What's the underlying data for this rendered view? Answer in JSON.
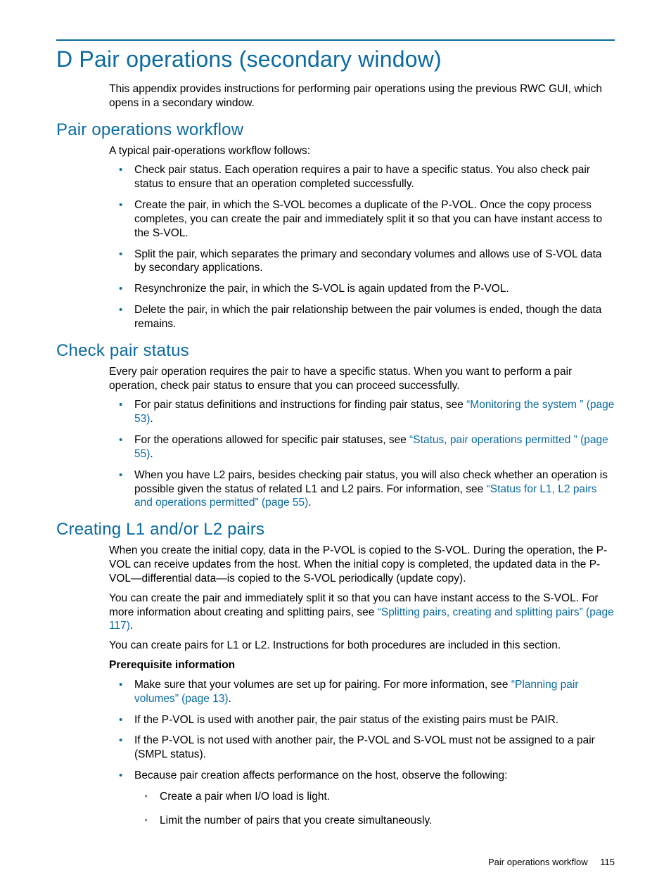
{
  "appendix_title": "D Pair operations (secondary window)",
  "intro": "This appendix provides instructions for performing pair operations using the previous RWC GUI, which opens in a secondary window.",
  "sections": {
    "workflow": {
      "title": "Pair operations workflow",
      "lead": "A typical pair-operations workflow follows:",
      "items": [
        "Check pair status. Each operation requires a pair to have a specific status. You also check pair status to ensure that an operation completed successfully.",
        "Create the pair, in which the S-VOL becomes a duplicate of the P-VOL. Once the copy process completes, you can create the pair and immediately split it so that you can have instant access to the S-VOL.",
        "Split the pair, which separates the primary and secondary volumes and allows use of S-VOL data by secondary applications.",
        "Resynchronize the pair, in which the S-VOL is again updated from the P-VOL.",
        "Delete the pair, in which the pair relationship between the pair volumes is ended, though the data remains."
      ]
    },
    "check": {
      "title": "Check pair status",
      "lead": "Every pair operation requires the pair to have a specific status. When you want to perform a pair operation, check pair status to ensure that you can proceed successfully.",
      "items": {
        "b1_pre": "For pair status definitions and instructions for finding pair status, see ",
        "b1_link": "“Monitoring the system ” (page 53)",
        "b1_post": ".",
        "b2_pre": "For the operations allowed for specific pair statuses, see ",
        "b2_link": "“Status, pair operations permitted ” (page 55)",
        "b2_post": ".",
        "b3_pre": "When you have L2 pairs, besides checking pair status, you will also check whether an operation is possible given the status of related L1 and L2 pairs. For information, see ",
        "b3_link": "“Status for L1, L2 pairs and operations permitted” (page 55)",
        "b3_post": "."
      }
    },
    "create": {
      "title": "Creating L1 and/or L2 pairs",
      "p1": "When you create the initial copy, data in the P-VOL is copied to the S-VOL. During the operation, the P-VOL can receive updates from the host. When the initial copy is completed, the updated data in the P-VOL—differential data—is copied to the S-VOL periodically (update copy).",
      "p2_pre": "You can create the pair and immediately split it so that you can have instant access to the S-VOL. For more information about creating and splitting pairs, see ",
      "p2_link": "“Splitting pairs, creating and splitting pairs” (page 117)",
      "p2_post": ".",
      "p3": "You can create pairs for L1 or L2. Instructions for both procedures are included in this section.",
      "prereq_label": "Prerequisite information",
      "items": {
        "c1_pre": "Make sure that your volumes are set up for pairing. For more information, see ",
        "c1_link": "“Planning pair volumes” (page 13)",
        "c1_post": ".",
        "c2": "If the P-VOL is used with another pair, the pair status of the existing pairs must be PAIR.",
        "c3": "If the P-VOL is not used with another pair, the P-VOL and S-VOL must not be assigned to a pair (SMPL status).",
        "c4": "Because pair creation affects performance on the host, observe the following:",
        "c4_sub1": "Create a pair when I/O load is light.",
        "c4_sub2": "Limit the number of pairs that you create simultaneously."
      }
    }
  },
  "footer": {
    "text": "Pair operations workflow",
    "page": "115"
  }
}
